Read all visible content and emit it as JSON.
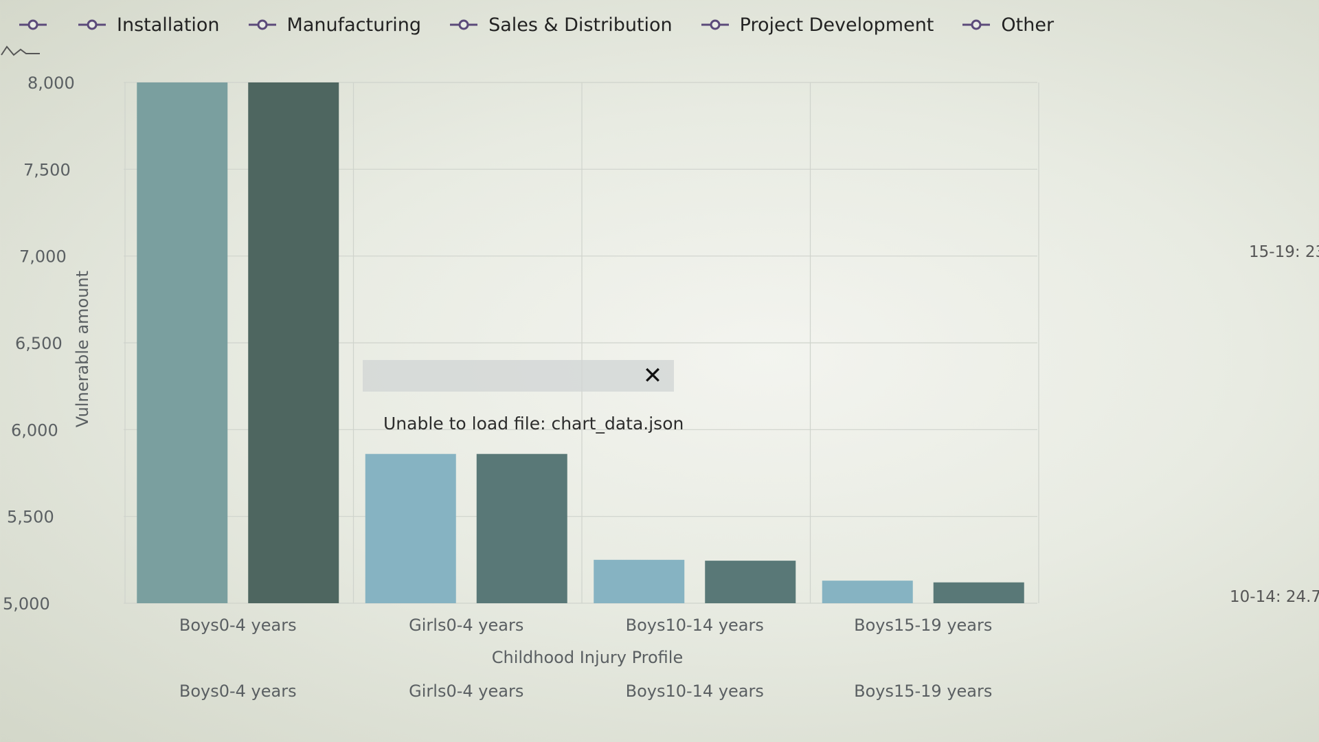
{
  "legend": {
    "items": [
      {
        "label": "",
        "color": "#5b4a7a"
      },
      {
        "label": "Installation",
        "color": "#5b4a7a"
      },
      {
        "label": "Manufacturing",
        "color": "#5b4a7a"
      },
      {
        "label": "Sales & Distribution",
        "color": "#5b4a7a"
      },
      {
        "label": "Project Development",
        "color": "#5b4a7a"
      },
      {
        "label": "Other",
        "color": "#5b4a7a"
      }
    ]
  },
  "dialog": {
    "message": "Unable to load file: chart_data.json",
    "close_icon": "close-icon"
  },
  "side_labels": {
    "upper": "15-19: 23",
    "lower": "10-14: 24.7"
  },
  "colors": {
    "light_bar": "#86b3c2",
    "dark_bar": "#597877",
    "first_light_bar": "#7a9f9f",
    "first_dark_bar": "#4e6660",
    "grid": "#cfd3cc"
  },
  "chart_data": {
    "type": "bar",
    "title": "",
    "xlabel": "Childhood Injury Profile",
    "ylabel": "Vulnerable amount",
    "ylim": [
      5000,
      8000
    ],
    "y_ticks": [
      5000,
      5500,
      6000,
      6500,
      7000,
      7500,
      8000
    ],
    "y_tick_labels": [
      "5,000",
      "5,500",
      "6,000",
      "6,500",
      "7,000",
      "7,500",
      "8,000"
    ],
    "categories": [
      "Boys0-4 years",
      "Girls0-4 years",
      "Boys10-14 years",
      "Boys15-19 years"
    ],
    "category_labels_repeat": [
      "Boys0-4 years",
      "Girls0-4 years",
      "Boys10-14 years",
      "Boys15-19 years"
    ],
    "grid": true,
    "series": [
      {
        "values": [
          8000,
          5860,
          5250,
          5130
        ]
      },
      {
        "values": [
          8000,
          5860,
          5245,
          5120
        ]
      }
    ]
  }
}
